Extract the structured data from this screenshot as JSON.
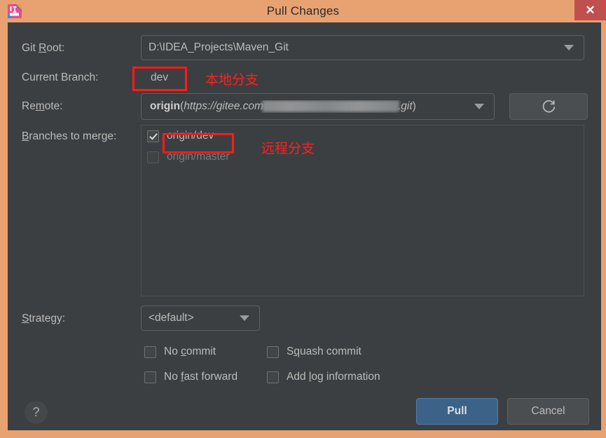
{
  "window": {
    "title": "Pull Changes",
    "app_icon": "intellij-idea-icon",
    "close_label": "✕",
    "accent_border_color": "#E8A170",
    "body_background": "#3C3F41",
    "close_button_color": "#C0504D"
  },
  "form": {
    "git_root": {
      "label_pre": "Git ",
      "label_mnemonic": "R",
      "label_post": "oot:",
      "value": "D:\\IDEA_Projects\\Maven_Git"
    },
    "current_branch": {
      "label": "Current Branch:",
      "value": "dev"
    },
    "remote": {
      "label_pre": "Re",
      "label_mnemonic": "m",
      "label_post": "ote:",
      "value_name": "origin",
      "value_open_paren": "(",
      "value_url_prefix": "https://gitee.com",
      "value_url_suffix": ".git",
      "value_close_paren": ")",
      "redacted": true
    },
    "refresh_button": {
      "icon": "refresh-icon",
      "tooltip": "Refresh"
    },
    "branches_to_merge": {
      "label_pre": "",
      "label_mnemonic": "B",
      "label_post": "ranches to merge:",
      "items": [
        {
          "name": "origin/dev",
          "checked": true,
          "enabled": true
        },
        {
          "name": "origin/master",
          "checked": false,
          "enabled": false
        }
      ]
    },
    "strategy": {
      "label_pre": "",
      "label_mnemonic": "S",
      "label_post": "trategy:",
      "value": "<default>"
    },
    "options": [
      {
        "id": "no-commit",
        "pre": "No ",
        "mnemonic": "c",
        "post": "ommit",
        "checked": false
      },
      {
        "id": "squash-commit",
        "pre": "S",
        "mnemonic": "q",
        "post": "uash commit",
        "checked": false
      },
      {
        "id": "no-fast-forward",
        "pre": "No ",
        "mnemonic": "f",
        "post": "ast forward",
        "checked": false
      },
      {
        "id": "add-log-info",
        "pre": "Add ",
        "mnemonic": "l",
        "post": "og information",
        "checked": false
      }
    ]
  },
  "footer": {
    "help_label": "?",
    "pull_label": "Pull",
    "cancel_label": "Cancel",
    "pull_button_color": "#3C6287"
  },
  "annotations": [
    {
      "id": "local-branch-note",
      "text": "本地分支",
      "color": "#FF2020"
    },
    {
      "id": "remote-branch-note",
      "text": "远程分支",
      "color": "#FF2020"
    }
  ]
}
